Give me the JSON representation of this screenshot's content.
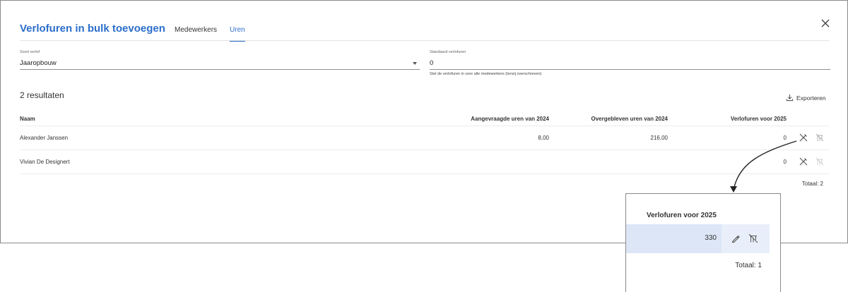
{
  "modal": {
    "title": "Verlofuren in bulk toevoegen",
    "tabs": [
      {
        "label": "Medewerkers",
        "active": false
      },
      {
        "label": "Uren",
        "active": true
      }
    ]
  },
  "form": {
    "leave_type": {
      "label": "Soort verlof",
      "value": "Jaaropbouw"
    },
    "default_hours": {
      "label": "Standaard verlofuren",
      "value": "0",
      "helper": "Stel de verlofuren in voor alle medewerkers (tenzij overschreven)"
    }
  },
  "results_label": "2 resultaten",
  "export_label": "Exporteren",
  "table": {
    "columns": [
      "Naam",
      "Aangevraagde uren van 2024",
      "Overgebleven uren van 2024",
      "Verlofuren voor 2025"
    ],
    "rows": [
      {
        "name": "Alexander Janssen",
        "requested": "8,00",
        "remaining": "216,00",
        "hours2025": "0"
      },
      {
        "name": "Vivian De Designert",
        "requested": "",
        "remaining": "",
        "hours2025": "0"
      }
    ],
    "total": "Totaal: 2"
  },
  "callout": {
    "header": "Verlofuren voor 2025",
    "value": "330",
    "total": "Totaal: 1"
  },
  "colors": {
    "accent": "#2c6ecb",
    "highlight": "#dce6f7"
  },
  "icons": [
    "close-icon",
    "chevron-down-icon",
    "download-icon",
    "edit-icon",
    "reset-icon",
    "arrow-icon"
  ]
}
